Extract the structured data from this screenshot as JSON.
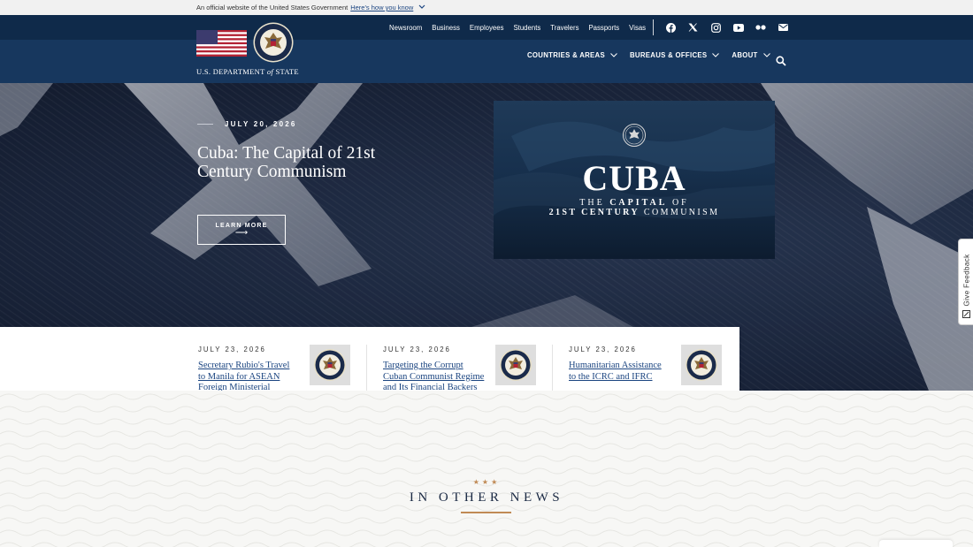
{
  "gov_banner": {
    "text": "An official website of the United States Government",
    "link": "Here's how you know"
  },
  "header": {
    "dept_prefix": "U.S. DEPARTMENT",
    "dept_of": "of",
    "dept_suffix": "STATE",
    "top_nav": [
      "Newsroom",
      "Business",
      "Employees",
      "Students",
      "Travelers",
      "Passports",
      "Visas"
    ],
    "social_icons": [
      "facebook-icon",
      "x-icon",
      "instagram-icon",
      "youtube-icon",
      "flickr-icon",
      "email-icon"
    ],
    "main_nav": [
      "COUNTRIES & AREAS",
      "BUREAUS & OFFICES",
      "ABOUT"
    ]
  },
  "hero": {
    "date": "JULY 20, 2026",
    "title": "Cuba: The Capital of 21st Century Communism",
    "button": "LEARN MORE",
    "button_arrow": "⟶",
    "card": {
      "big": "CUBA",
      "line1_pre": "THE ",
      "line1_bold": "CAPITAL",
      "line1_post": " OF",
      "line2_bold": "21ST CENTURY",
      "line2_post": " COMMUNISM"
    }
  },
  "news": [
    {
      "date": "JULY 23, 2026",
      "title": "Secretary Rubio's Travel to Manila for ASEAN Foreign Ministerial Meetings"
    },
    {
      "date": "JULY 23, 2026",
      "title": "Targeting the Corrupt Cuban Communist Regime and Its Financial Backers"
    },
    {
      "date": "JULY 23, 2026",
      "title": "Humanitarian Assistance to the ICRC and IFRC"
    }
  ],
  "other_news": {
    "stars": "★★★",
    "title": "IN OTHER NEWS"
  },
  "feedback": {
    "label": "Give Feedback"
  },
  "colors": {
    "navy": "#17375e",
    "navy_dark": "#0f2a4a",
    "link_blue": "#1a4480",
    "gold": "#c08a55"
  }
}
